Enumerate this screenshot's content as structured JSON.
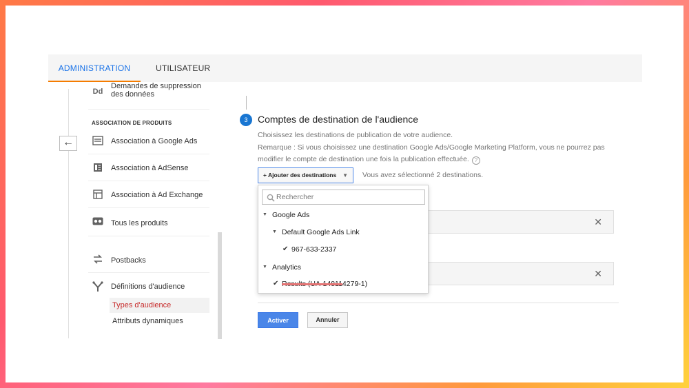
{
  "tabs": [
    {
      "label": "ADMINISTRATION",
      "active": true
    },
    {
      "label": "UTILISATEUR",
      "active": false
    }
  ],
  "sidebar": {
    "items_top": [
      {
        "icon": "data-deletion-icon",
        "glyph": "Dd",
        "label": "Demandes de suppression des données"
      }
    ],
    "section_header": "ASSOCIATION DE PRODUITS",
    "product_links": [
      {
        "icon": "google-ads-icon",
        "label": "Association à Google Ads"
      },
      {
        "icon": "adsense-icon",
        "label": "Association à AdSense"
      },
      {
        "icon": "ad-exchange-icon",
        "label": "Association à Ad Exchange"
      },
      {
        "icon": "all-products-icon",
        "label": "Tous les produits"
      }
    ],
    "other_items": [
      {
        "icon": "postbacks-icon",
        "label": "Postbacks"
      },
      {
        "icon": "audience-definitions-icon",
        "label": "Définitions d'audience"
      }
    ],
    "sub_items": [
      {
        "label": "Types d'audience",
        "active": true
      },
      {
        "label": "Attributs dynamiques",
        "active": false
      }
    ]
  },
  "step": {
    "number": "3",
    "title": "Comptes de destination de l'audience",
    "description": "Choisissez les destinations de publication de votre audience.",
    "note": "Remarque : Si vous choisissez une destination Google Ads/Google Marketing Platform, vous ne pourrez pas modifier le compte de destination une fois la publication effectuée.",
    "help_glyph": "?"
  },
  "add_button": {
    "label": "+ Ajouter des destinations"
  },
  "selected_text": "Vous avez sélectionné 2 destinations.",
  "dropdown": {
    "search_placeholder": "Rechercher",
    "tree": [
      {
        "level": 0,
        "type": "group",
        "label": "Google Ads"
      },
      {
        "level": 1,
        "type": "group",
        "label": "Default Google Ads Link"
      },
      {
        "level": 2,
        "type": "item",
        "checked": true,
        "label": "967-633-2337"
      },
      {
        "level": 0,
        "type": "group",
        "label": "Analytics"
      },
      {
        "level": 1,
        "type": "item",
        "checked": true,
        "label": "Results (UA-148114279-1)"
      }
    ]
  },
  "remove_glyph": "✕",
  "buttons": {
    "activate": "Activer",
    "cancel": "Annuler"
  },
  "colors": {
    "accent_blue": "#1a73e8",
    "tab_underline": "#f57c00",
    "primary_button": "#4a86e8",
    "active_sub_item_text": "#c62828"
  }
}
